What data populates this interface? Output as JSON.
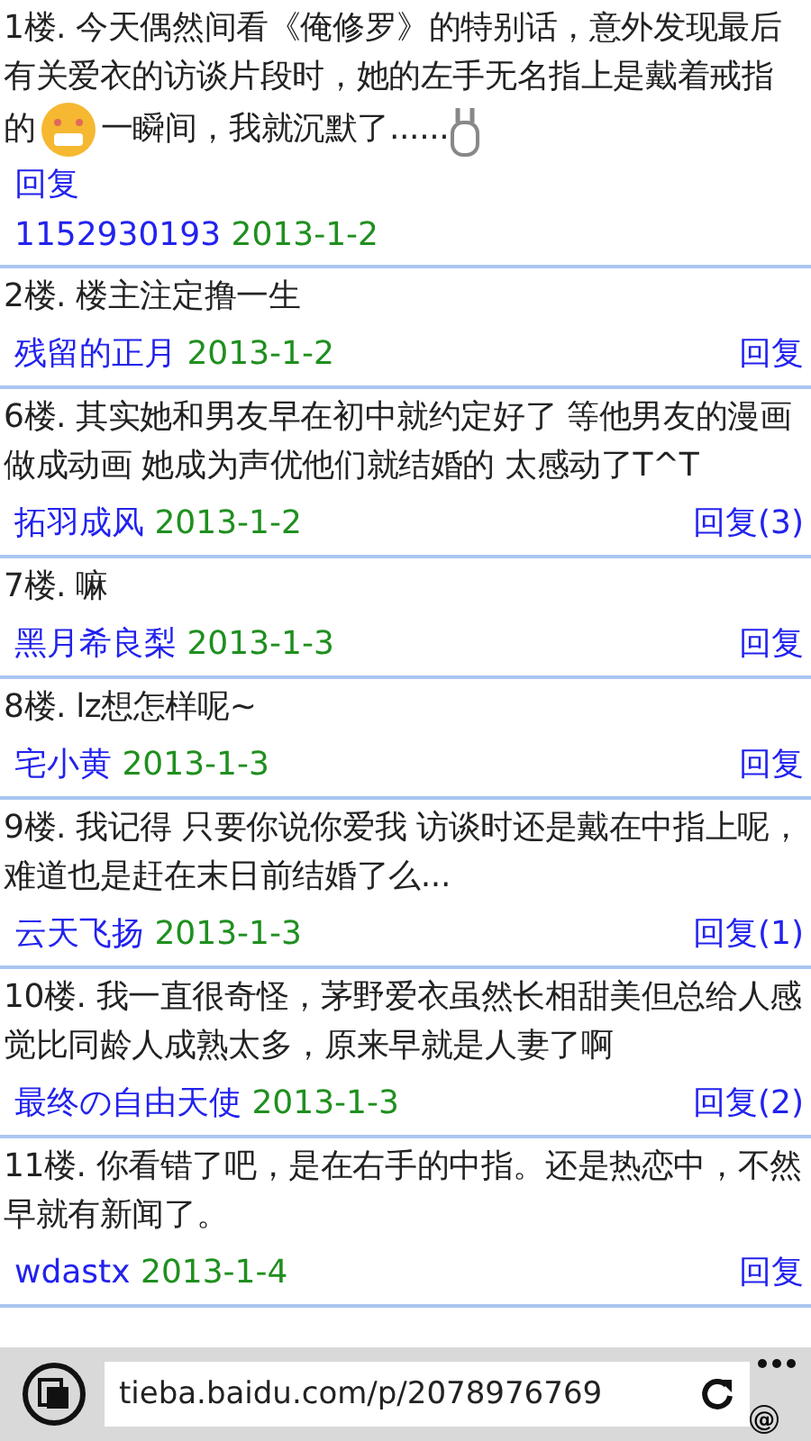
{
  "posts": [
    {
      "body": [
        {
          "kind": "text",
          "text": "1楼. 今天偶然间看《俺修罗》的特别话，意外发现最后有关爱衣的访谈片段时，她的左手无名指上是戴着戒指的"
        },
        {
          "kind": "smiley"
        },
        {
          "kind": "text",
          "text": "一瞬间，我就沉默了......"
        },
        {
          "kind": "rabbit"
        }
      ],
      "author": "1152930193",
      "date": "2013-1-2",
      "reply": "回复",
      "kind": "opening"
    },
    {
      "body": [
        {
          "kind": "text",
          "text": "2楼. 楼主注定撸一生"
        }
      ],
      "author": "残留的正月",
      "date": "2013-1-2",
      "reply": "回复",
      "kind": "reply"
    },
    {
      "body": [
        {
          "kind": "text",
          "text": "6楼. 其实她和男友早在初中就约定好了 等他男友的漫画做成动画 她成为声优他们就结婚的 太感动了T^T"
        }
      ],
      "author": "拓羽成风",
      "date": "2013-1-2",
      "reply": "回复(3)",
      "kind": "reply"
    },
    {
      "body": [
        {
          "kind": "text",
          "text": "7楼. 嘛"
        }
      ],
      "author": "黑月希良梨",
      "date": "2013-1-3",
      "reply": "回复",
      "kind": "reply"
    },
    {
      "body": [
        {
          "kind": "text",
          "text": "8楼. lz想怎样呢~"
        }
      ],
      "author": "宅小黄",
      "date": "2013-1-3",
      "reply": "回复",
      "kind": "reply"
    },
    {
      "body": [
        {
          "kind": "text",
          "text": "9楼. 我记得 只要你说你爱我 访谈时还是戴在中指上呢，难道也是赶在末日前结婚了么..."
        }
      ],
      "author": "云天飞扬",
      "date": "2013-1-3",
      "reply": "回复(1)",
      "kind": "reply"
    },
    {
      "body": [
        {
          "kind": "text",
          "text": "10楼. 我一直很奇怪，茅野爱衣虽然长相甜美但总给人感觉比同龄人成熟太多，原来早就是人妻了啊"
        }
      ],
      "author": "最终の自由天使",
      "date": "2013-1-3",
      "reply": "回复(2)",
      "kind": "reply"
    },
    {
      "body": [
        {
          "kind": "text",
          "text": "11楼. 你看错了吧，是在右手的中指。还是热恋中，不然早就有新闻了。"
        }
      ],
      "author": "wdastx",
      "date": "2013-1-4",
      "reply": "回复",
      "kind": "reply"
    }
  ],
  "address_bar": {
    "url": "tieba.baidu.com/p/2078976769",
    "badge": "@"
  }
}
